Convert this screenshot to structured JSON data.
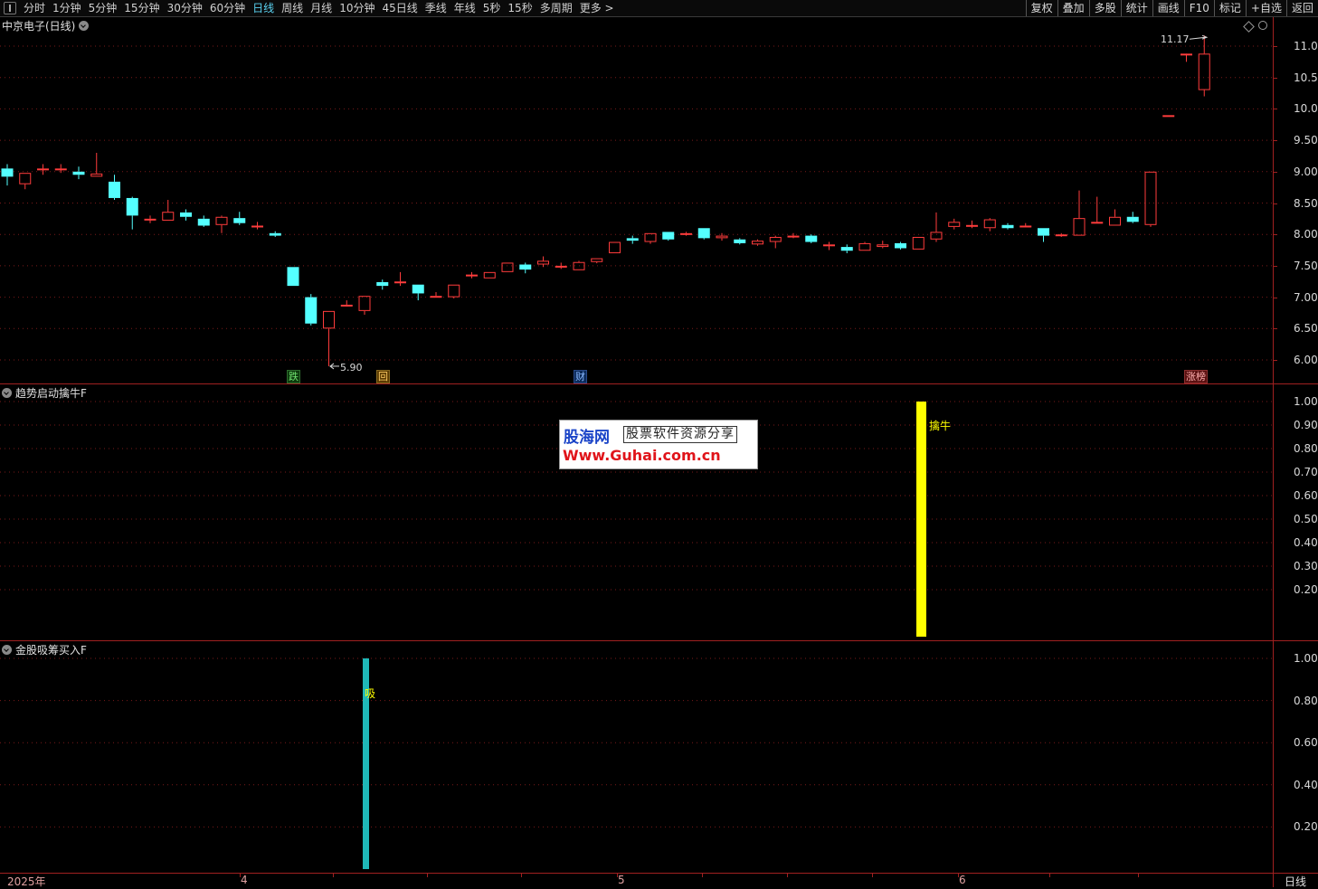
{
  "toolbar": {
    "periods": [
      "分时",
      "1分钟",
      "5分钟",
      "15分钟",
      "30分钟",
      "60分钟",
      "日线",
      "周线",
      "月线",
      "10分钟",
      "45日线",
      "季线",
      "年线",
      "5秒",
      "15秒",
      "多周期",
      "更多 >"
    ],
    "active_period": "日线",
    "tools": [
      "复权",
      "叠加",
      "多股",
      "统计",
      "画线",
      "F10",
      "标记",
      "+自选",
      "返回"
    ]
  },
  "main_panel": {
    "title": "中京电子(日线)",
    "y_ticks": [
      "11.00",
      "10.50",
      "10.00",
      "9.50",
      "9.00",
      "8.50",
      "8.00",
      "7.50",
      "7.00",
      "6.50",
      "6.00"
    ],
    "high_label": "11.17",
    "low_label": "5.90",
    "event_tags": [
      {
        "text": "跌",
        "kind": "die"
      },
      {
        "text": "回",
        "kind": "hui"
      },
      {
        "text": "财",
        "kind": "cai"
      },
      {
        "text": "涨榜",
        "kind": "zb"
      }
    ]
  },
  "indicator1": {
    "title": "趋势启动擒牛F",
    "y_ticks": [
      "1.00",
      "0.90",
      "0.80",
      "0.70",
      "0.60",
      "0.50",
      "0.40",
      "0.30",
      "0.20"
    ],
    "signal_label": "擒牛",
    "color": "#ffff00"
  },
  "indicator2": {
    "title": "金股吸筹买入F",
    "y_ticks": [
      "1.00",
      "0.80",
      "0.60",
      "0.40",
      "0.20"
    ],
    "signal_label": "吸",
    "color": "#1fb8b8"
  },
  "watermark": {
    "brand": "股海网",
    "subtitle": "股票软件资源分享",
    "url": "Www.Guhai.com.cn"
  },
  "x_axis": {
    "labels": [
      "2025年",
      "4",
      "5",
      "6"
    ],
    "period_name": "日线"
  },
  "chart_data": {
    "type": "candlestick",
    "title": "中京电子(日线)",
    "ylim": [
      5.75,
      11.25
    ],
    "up_color": "#ff3c3c",
    "down_color": "#54ffff",
    "candles": [
      [
        9.05,
        8.92,
        9.12,
        8.78
      ],
      [
        8.8,
        8.98,
        8.98,
        8.72
      ],
      [
        9.05,
        9.05,
        9.12,
        8.95
      ],
      [
        9.05,
        9.05,
        9.12,
        8.98
      ],
      [
        9.0,
        8.95,
        9.08,
        8.88
      ],
      [
        8.92,
        8.97,
        9.3,
        8.92
      ],
      [
        8.84,
        8.58,
        8.95,
        8.55
      ],
      [
        8.58,
        8.3,
        8.6,
        8.08
      ],
      [
        8.25,
        8.25,
        8.3,
        8.18
      ],
      [
        8.22,
        8.36,
        8.55,
        8.22
      ],
      [
        8.35,
        8.28,
        8.4,
        8.22
      ],
      [
        8.25,
        8.14,
        8.3,
        8.12
      ],
      [
        8.15,
        8.28,
        8.3,
        8.02
      ],
      [
        8.26,
        8.18,
        8.36,
        8.15
      ],
      [
        8.14,
        8.14,
        8.2,
        8.08
      ],
      [
        8.02,
        7.98,
        8.05,
        7.96
      ],
      [
        7.48,
        7.18,
        7.48,
        7.18
      ],
      [
        7.0,
        6.58,
        7.05,
        6.55
      ],
      [
        6.5,
        6.78,
        6.78,
        5.9
      ],
      [
        6.88,
        6.88,
        6.95,
        6.85
      ],
      [
        6.78,
        7.02,
        7.02,
        6.72
      ],
      [
        7.24,
        7.18,
        7.28,
        7.12
      ],
      [
        7.25,
        7.25,
        7.4,
        7.18
      ],
      [
        7.2,
        7.06,
        7.2,
        6.95
      ],
      [
        7.02,
        7.02,
        7.08,
        7.02
      ],
      [
        7.0,
        7.2,
        7.2,
        6.98
      ],
      [
        7.36,
        7.36,
        7.4,
        7.3
      ],
      [
        7.3,
        7.4,
        7.4,
        7.3
      ],
      [
        7.4,
        7.55,
        7.55,
        7.4
      ],
      [
        7.52,
        7.44,
        7.55,
        7.38
      ],
      [
        7.52,
        7.58,
        7.65,
        7.48
      ],
      [
        7.5,
        7.5,
        7.55,
        7.45
      ],
      [
        7.43,
        7.56,
        7.58,
        7.43
      ],
      [
        7.56,
        7.62,
        7.62,
        7.54
      ],
      [
        7.7,
        7.88,
        7.88,
        7.7
      ],
      [
        7.94,
        7.9,
        7.98,
        7.85
      ],
      [
        7.88,
        8.02,
        8.02,
        7.85
      ],
      [
        8.04,
        7.92,
        8.04,
        7.9
      ],
      [
        8.0,
        8.02,
        8.04,
        7.98
      ],
      [
        8.1,
        7.94,
        8.1,
        7.92
      ],
      [
        7.94,
        7.98,
        8.02,
        7.9
      ],
      [
        7.92,
        7.86,
        7.94,
        7.84
      ],
      [
        7.84,
        7.9,
        7.92,
        7.82
      ],
      [
        7.88,
        7.96,
        7.98,
        7.78
      ],
      [
        7.98,
        7.98,
        8.02,
        7.94
      ],
      [
        7.98,
        7.88,
        8.0,
        7.86
      ],
      [
        7.84,
        7.84,
        7.88,
        7.75
      ],
      [
        7.8,
        7.74,
        7.84,
        7.7
      ],
      [
        7.74,
        7.86,
        7.88,
        7.74
      ],
      [
        7.8,
        7.84,
        7.9,
        7.78
      ],
      [
        7.86,
        7.78,
        7.88,
        7.76
      ],
      [
        7.76,
        7.96,
        7.96,
        7.76
      ],
      [
        7.92,
        8.04,
        8.35,
        7.88
      ],
      [
        8.12,
        8.2,
        8.25,
        8.08
      ],
      [
        8.15,
        8.15,
        8.22,
        8.1
      ],
      [
        8.1,
        8.24,
        8.26,
        8.05
      ],
      [
        8.15,
        8.1,
        8.18,
        8.08
      ],
      [
        8.14,
        8.14,
        8.18,
        8.12
      ],
      [
        8.1,
        7.98,
        8.1,
        7.88
      ],
      [
        8.0,
        8.0,
        8.02,
        7.96
      ],
      [
        7.98,
        8.26,
        8.7,
        7.98
      ],
      [
        8.2,
        8.2,
        8.6,
        8.18
      ],
      [
        8.14,
        8.28,
        8.4,
        8.14
      ],
      [
        8.28,
        8.2,
        8.36,
        8.18
      ],
      [
        8.15,
        9.0,
        9.0,
        8.12
      ],
      [
        9.9,
        9.9,
        9.9,
        9.9
      ],
      [
        10.88,
        10.88,
        10.88,
        10.75
      ],
      [
        10.3,
        10.88,
        11.17,
        10.2
      ]
    ]
  }
}
